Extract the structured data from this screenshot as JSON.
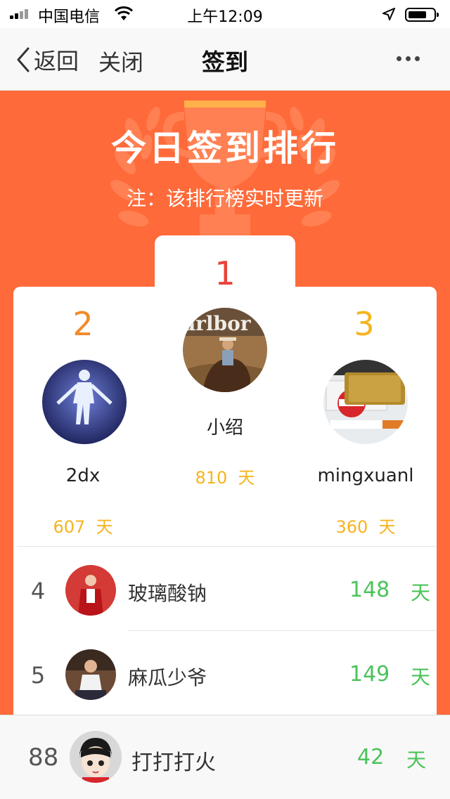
{
  "status_bar": {
    "carrier": "中国电信",
    "time": "上午12:09"
  },
  "nav": {
    "back_label": "返回",
    "close_label": "关闭",
    "title": "签到"
  },
  "banner": {
    "title": "今日签到排行",
    "note": "注：该排行榜实时更新"
  },
  "podium": [
    {
      "rank": "1",
      "name": "小绍",
      "days": "810",
      "unit": "天",
      "rank_color": "#e8433b"
    },
    {
      "rank": "2",
      "name": "2dx",
      "days": "607",
      "unit": "天",
      "rank_color": "#f28a2a"
    },
    {
      "rank": "3",
      "name": "mingxuanl",
      "days": "360",
      "unit": "天",
      "rank_color": "#f5b41f"
    }
  ],
  "list": [
    {
      "rank": "4",
      "name": "玻璃酸钠",
      "days": "148",
      "unit": "天"
    },
    {
      "rank": "5",
      "name": "麻瓜少爷",
      "days": "149",
      "unit": "天"
    }
  ],
  "me": {
    "rank": "88",
    "name": "打打打火",
    "days": "42",
    "unit": "天"
  },
  "colors": {
    "banner_bg": "#ff6a3a",
    "days_green": "#4cc35a",
    "days_gold": "#f5b41f"
  }
}
